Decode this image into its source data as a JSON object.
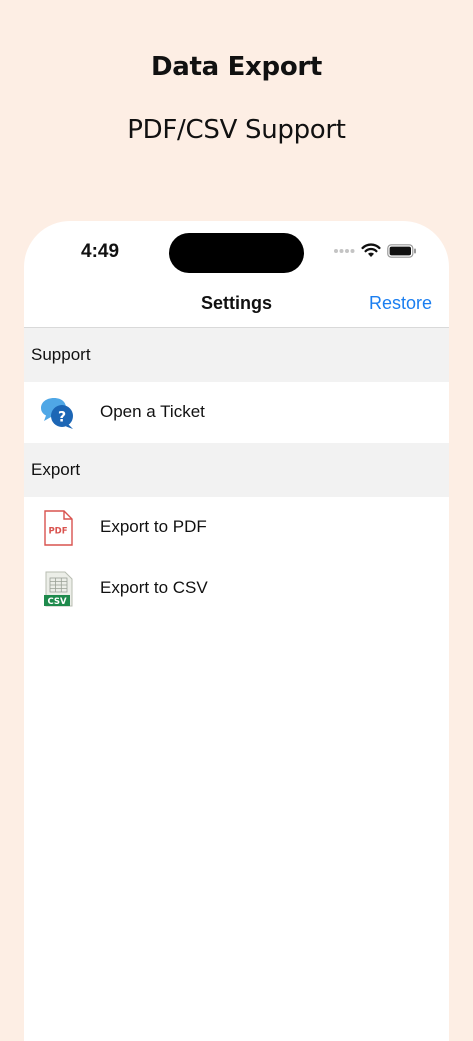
{
  "promo": {
    "title": "Data Export",
    "subtitle": "PDF/CSV Support"
  },
  "status_bar": {
    "time": "4:49"
  },
  "nav": {
    "title": "Settings",
    "restore_label": "Restore"
  },
  "sections": {
    "support": {
      "header": "Support",
      "items": [
        {
          "label": "Open a Ticket",
          "icon": "support-ticket-icon"
        }
      ]
    },
    "export": {
      "header": "Export",
      "items": [
        {
          "label": "Export to PDF",
          "icon": "pdf-file-icon"
        },
        {
          "label": "Export to CSV",
          "icon": "csv-file-icon"
        }
      ]
    }
  },
  "colors": {
    "background": "#fdeee4",
    "accent": "#1a7ef0",
    "section_bg": "#f2f2f2"
  }
}
